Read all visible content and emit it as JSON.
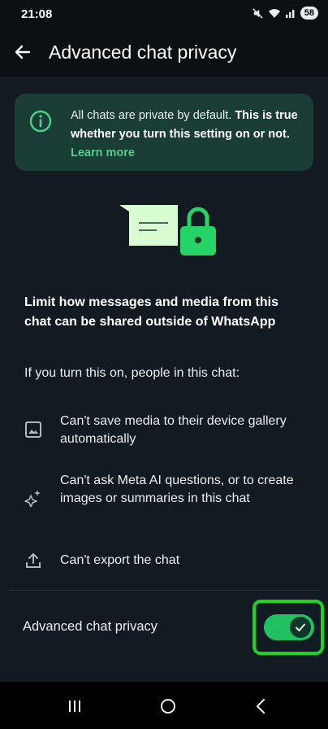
{
  "status_bar": {
    "time": "21:08",
    "battery": "58",
    "icons": [
      "mute-icon",
      "wifi-icon",
      "signal-icon",
      "battery-icon"
    ]
  },
  "app_bar": {
    "title": "Advanced chat privacy",
    "back_icon": "arrow-left-icon"
  },
  "info_banner": {
    "text_normal": "All chats are private by default. ",
    "text_bold": "This is true whether you turn this setting on or not.",
    "link": "Learn more",
    "icon": "info-circle-icon"
  },
  "main": {
    "heading": "Limit how messages and media from this chat can be shared outside of WhatsApp",
    "subheading": "If you turn this on, people in this chat:",
    "features": [
      {
        "icon": "image-icon",
        "label": "Can't save media to their device gallery automatically"
      },
      {
        "icon": "sparkle-icon",
        "label": "Can't ask Meta AI questions, or to create images or summaries in this chat"
      },
      {
        "icon": "upload-icon",
        "label": "Can't export the chat"
      }
    ]
  },
  "setting": {
    "label": "Advanced chat privacy",
    "enabled": true
  },
  "nav_bar": {
    "icons": [
      "recents-icon",
      "home-icon",
      "back-nav-icon"
    ]
  },
  "colors": {
    "background": "#121b22",
    "banner": "#1a3d35",
    "accent": "#21c063",
    "highlight": "#1fd21f"
  }
}
